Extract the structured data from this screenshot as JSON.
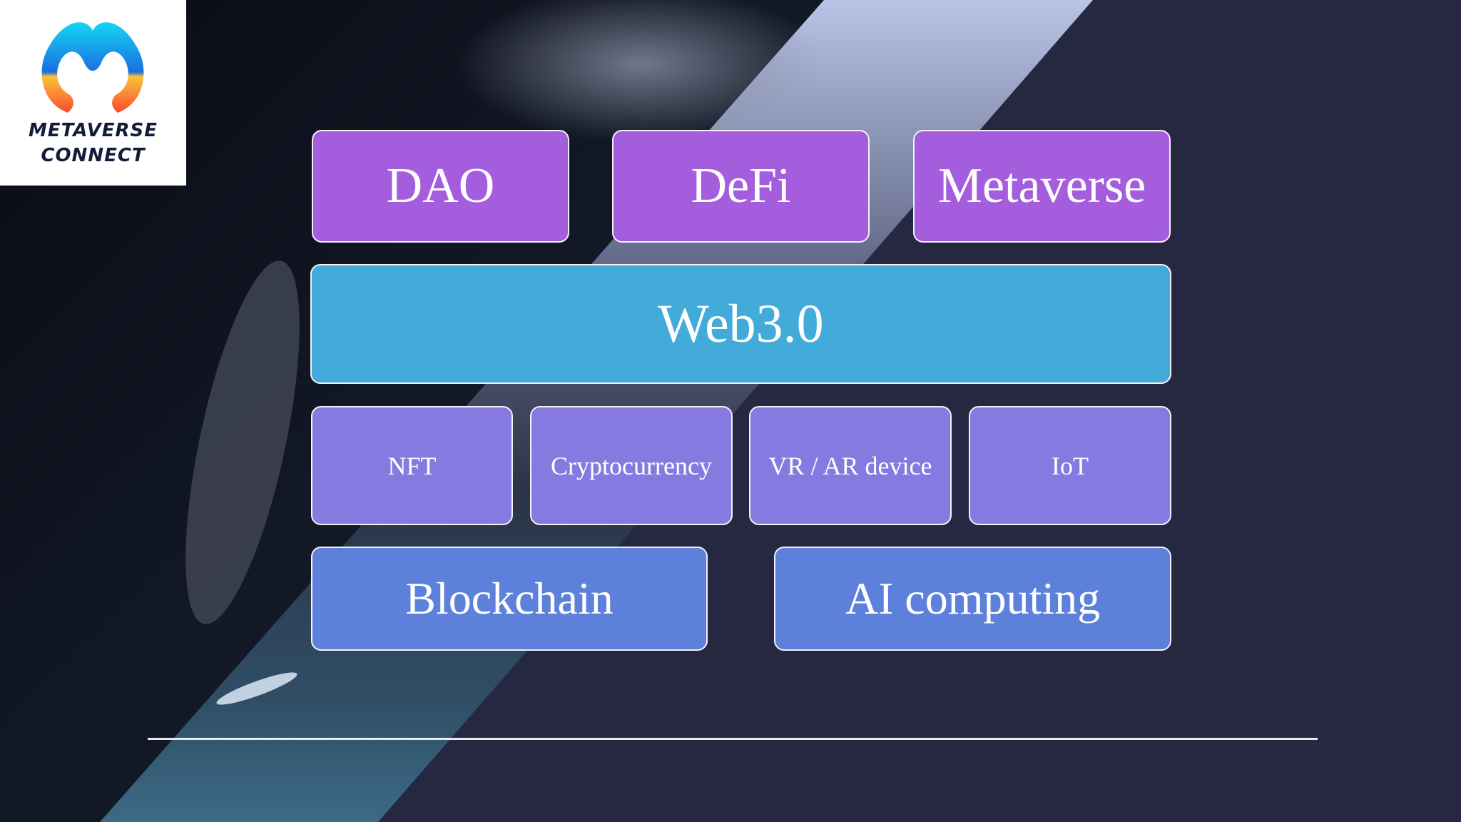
{
  "logo": {
    "line1": "METAVERSE",
    "line2": "CONNECT",
    "icon": "metaverse-connect-logo-icon"
  },
  "diagram": {
    "top_row": [
      {
        "label": "DAO"
      },
      {
        "label": "DeFi"
      },
      {
        "label": "Metaverse"
      }
    ],
    "platform": {
      "label": "Web3.0"
    },
    "tech_row": [
      {
        "label": "NFT"
      },
      {
        "label": "Cryptocurrency"
      },
      {
        "label": "VR / AR device"
      },
      {
        "label": "IoT"
      }
    ],
    "foundation_row": [
      {
        "label": "Blockchain"
      },
      {
        "label": "AI computing"
      }
    ]
  },
  "colors": {
    "background": "#262842",
    "top_row": "#a35ddd",
    "platform": "#43abda",
    "tech_row": "#867ae1",
    "foundation_row": "#5d80db"
  }
}
